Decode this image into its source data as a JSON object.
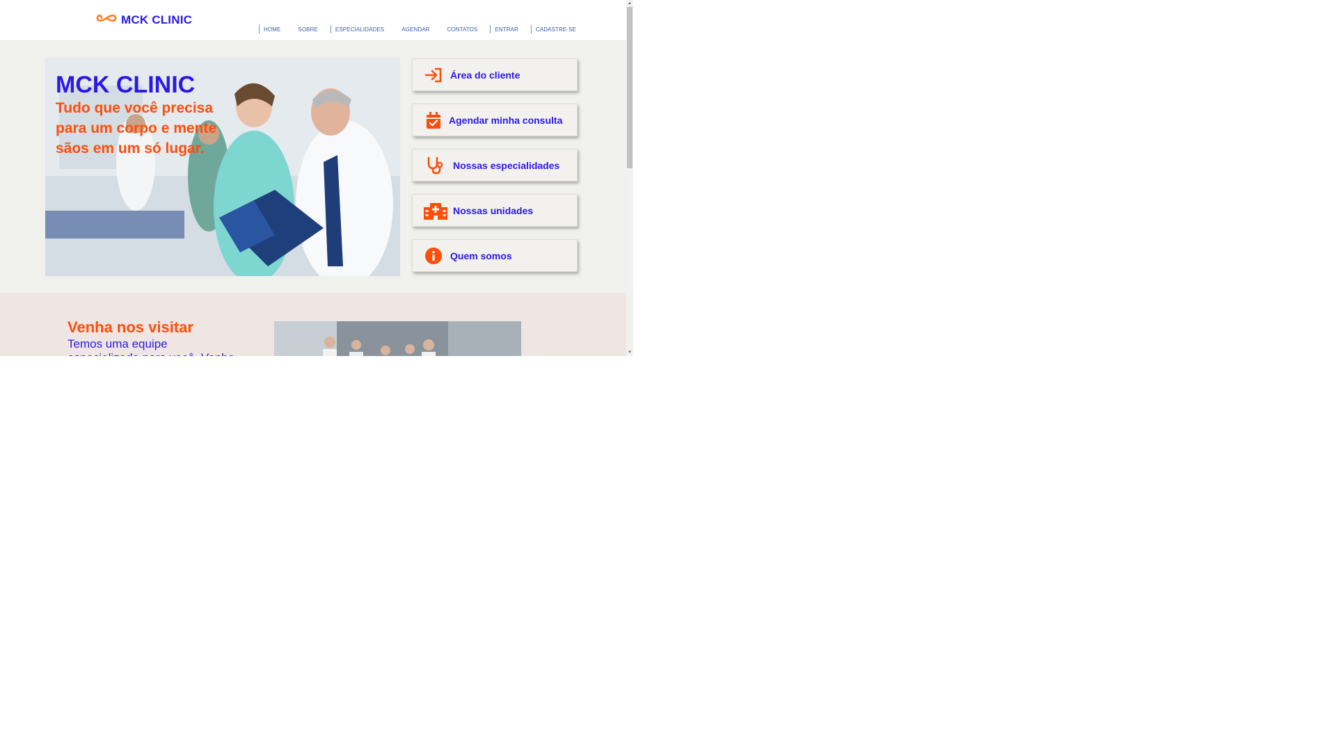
{
  "header": {
    "logo_text": "MCK CLINIC",
    "nav": [
      {
        "label": "HOME",
        "sep": true
      },
      {
        "label": "SOBRE",
        "sep": false
      },
      {
        "label": "ESPECIALIDADES",
        "sep": true
      },
      {
        "label": "AGENDAR",
        "sep": false
      },
      {
        "label": "CONTATOS",
        "sep": false
      },
      {
        "label": "ENTRAR",
        "sep": true
      },
      {
        "label": "CADASTRE-SE",
        "sep": true
      }
    ]
  },
  "hero": {
    "title": "MCK CLINIC",
    "subtitle": "Tudo que você precisa para um corpo e mente sãos em um só lugar."
  },
  "actions": [
    {
      "label": "Área do cliente",
      "icon": "login-icon"
    },
    {
      "label": "Agendar minha consulta",
      "icon": "calendar-check-icon"
    },
    {
      "label": "Nossas especialidades",
      "icon": "stethoscope-icon"
    },
    {
      "label": "Nossas unidades",
      "icon": "hospital-icon"
    },
    {
      "label": "Quem somos",
      "icon": "info-icon"
    }
  ],
  "visit": {
    "title": "Venha nos visitar",
    "text": "Temos uma equipe especializada para você. Venha"
  },
  "colors": {
    "brand_blue": "#2b18e8",
    "brand_orange": "#ff4d0a",
    "hero_bg": "#f0f0ec",
    "visit_bg": "#efe6e3"
  }
}
